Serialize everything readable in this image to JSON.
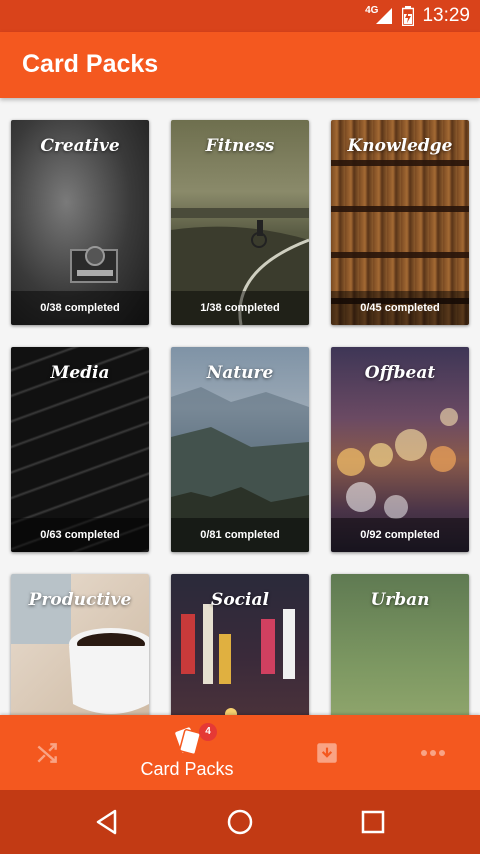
{
  "status_bar": {
    "network_label": "4G",
    "time": "13:29",
    "icons": [
      "signal-icon",
      "battery-icon"
    ]
  },
  "app_bar": {
    "title": "Card Packs"
  },
  "packs": [
    {
      "name": "Creative",
      "progress": "0/38 completed"
    },
    {
      "name": "Fitness",
      "progress": "1/38 completed"
    },
    {
      "name": "Knowledge",
      "progress": "0/45 completed"
    },
    {
      "name": "Media",
      "progress": "0/63 completed"
    },
    {
      "name": "Nature",
      "progress": "0/81 completed"
    },
    {
      "name": "Offbeat",
      "progress": "0/92 completed"
    },
    {
      "name": "Productive",
      "progress": ""
    },
    {
      "name": "Social",
      "progress": ""
    },
    {
      "name": "Urban",
      "progress": ""
    }
  ],
  "bottom_nav": {
    "items": [
      {
        "icon": "shuffle-icon",
        "label": ""
      },
      {
        "icon": "cards-icon",
        "label": "Card Packs",
        "badge": "4"
      },
      {
        "icon": "archive-icon",
        "label": ""
      },
      {
        "icon": "more-icon",
        "label": ""
      }
    ]
  },
  "system_nav": {
    "icons": [
      "back-icon",
      "home-icon",
      "recents-icon"
    ]
  },
  "colors": {
    "status_bar": "#d9431b",
    "app_bar": "#f4581f",
    "bottom_nav": "#f4581f",
    "system_nav": "#c23a14",
    "badge": "#e53935"
  }
}
